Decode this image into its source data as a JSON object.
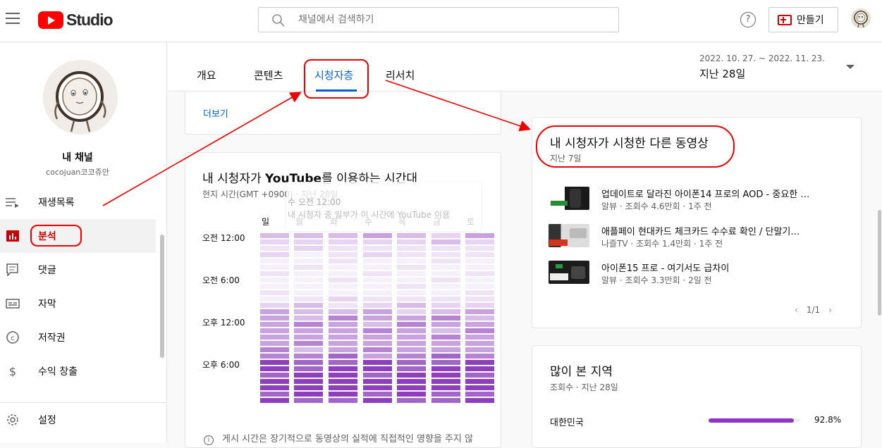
{
  "topbar": {
    "logo_text": "Studio",
    "search_placeholder": "채널에서 검색하기",
    "help_label": "?",
    "create_label": "만들기"
  },
  "sidebar": {
    "channel_title": "내 채널",
    "channel_handle": "cocojuan코코쥬안",
    "items": [
      {
        "label": "재생목록",
        "icon": "playlist-icon"
      },
      {
        "label": "분석",
        "icon": "analytics-icon",
        "active": true
      },
      {
        "label": "댓글",
        "icon": "comments-icon"
      },
      {
        "label": "자막",
        "icon": "subtitles-icon"
      },
      {
        "label": "저작권",
        "icon": "copyright-icon"
      },
      {
        "label": "수익 창출",
        "icon": "monetization-icon"
      },
      {
        "label": "설정",
        "icon": "gear-icon"
      }
    ]
  },
  "tabs": {
    "items": [
      "개요",
      "콘텐츠",
      "시청자층",
      "리서치"
    ],
    "selected": "시청자층"
  },
  "date_range": {
    "range": "2022. 10. 27. ~ 2022. 11. 23.",
    "label": "지난 28일"
  },
  "cards": {
    "more_link": "더보기",
    "watch_time": {
      "title_prefix": "내 시청자가 ",
      "title_bold": "YouTube",
      "title_suffix": "를 이용하는 시간대",
      "subtitle": "현지 시간(GMT +0900) · 지난 28일",
      "tooltip_line1": "수 오전 12:00",
      "tooltip_line2": "내 시청자 중 일부가 이 시간에 YouTube 이용",
      "days": [
        "일",
        "월",
        "화",
        "수",
        "목",
        "금",
        "토"
      ],
      "time_labels": [
        "오전 12:00",
        "오전 6:00",
        "오후 12:00",
        "오후 6:00"
      ],
      "footnote": "게시 시간은 장기적으로 동영상의 실적에 직접적인 영향을 주지 않"
    },
    "other_videos": {
      "title": "내 시청자가 시청한 다른 동영상",
      "subtitle": "지난 7일",
      "videos": [
        {
          "title": "업데이트로 달라진 아이폰14 프로의 AOD - 중요한 …",
          "meta": "알뷰 · 조회수 4.6만회 · 1주 전"
        },
        {
          "title": "애플페이 현대카드 체크카드 수수료 확인 / 단말기…",
          "meta": "나즐TV · 조회수 1.4만회 · 1주 전"
        },
        {
          "title": "아이폰15 프로 - 여기서도 급차이",
          "meta": "알뷰 · 조회수 3.3만회 · 2일 전"
        }
      ],
      "pager": "1/1"
    },
    "geography": {
      "title": "많이 본 지역",
      "subtitle": "조회수 · 지난 28일",
      "rows": [
        {
          "country": "대한민국",
          "percent_label": "92.8%",
          "value": 0.928
        }
      ]
    }
  }
}
